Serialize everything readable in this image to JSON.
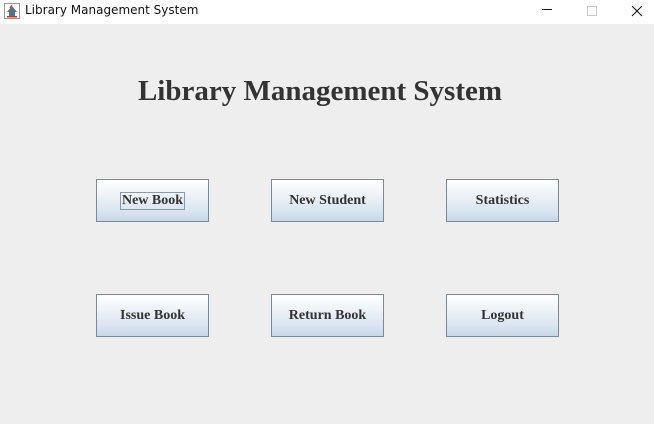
{
  "window": {
    "title": "Library Management System",
    "icon": "java-cup-icon",
    "controls": [
      "minimize-icon",
      "maximize-icon",
      "close-icon"
    ]
  },
  "main": {
    "heading": "Library Management System",
    "buttons": {
      "new_book": "New Book",
      "new_student": "New Student",
      "statistics": "Statistics",
      "issue_book": "Issue Book",
      "return_book": "Return Book",
      "logout": "Logout"
    },
    "focused_button": "new_book"
  },
  "colors": {
    "background": "#eeeeee",
    "heading_text": "#333333",
    "button_border": "#7a8a99",
    "button_gradient_bottom": "#c8d7e6"
  }
}
